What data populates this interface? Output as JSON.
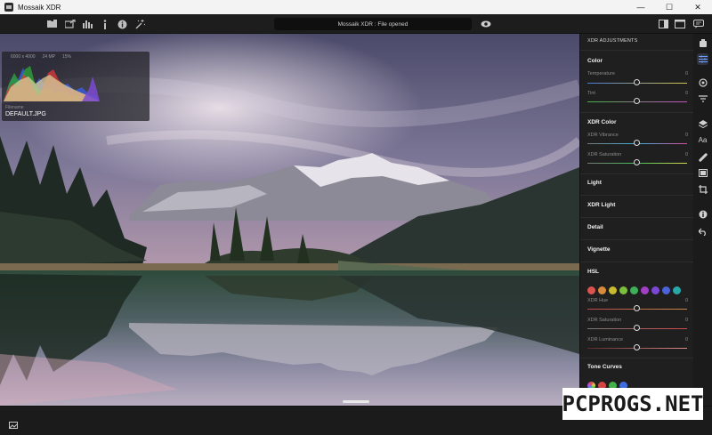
{
  "window": {
    "title": "Mossaik XDR",
    "minimize_glyph": "—",
    "maximize_glyph": "☐",
    "close_glyph": "✕"
  },
  "toolbar": {
    "status_text": "Mossaik XDR : File opened"
  },
  "histogram": {
    "stats": [
      "6000 x 4000",
      "24 MP",
      "15%"
    ],
    "filename_label": "Filename",
    "filename": "DEFAULT.JPG"
  },
  "panel": {
    "title": "XDR ADJUSTMENTS",
    "sections": {
      "color": "Color",
      "xdr_color": "XDR Color",
      "light": "Light",
      "xdr_light": "XDR Light",
      "detail": "Detail",
      "vignette": "Vignette",
      "hsl": "HSL",
      "tone_curves": "Tone Curves"
    },
    "sliders": {
      "temperature": {
        "label": "Temperature",
        "value": "0"
      },
      "tint": {
        "label": "Tint",
        "value": "0"
      },
      "xdr_vibrance": {
        "label": "XDR Vibrance",
        "value": "0"
      },
      "xdr_saturation": {
        "label": "XDR Saturation",
        "value": "0"
      },
      "xdr_hue": {
        "label": "XDR Hue",
        "value": "0"
      },
      "hsl_xdr_saturation": {
        "label": "XDR Saturation",
        "value": "0"
      },
      "xdr_luminance": {
        "label": "XDR Luminance",
        "value": "0"
      }
    },
    "hsl_swatches": [
      "#d9534f",
      "#d98a3a",
      "#c8b92e",
      "#7cbf3a",
      "#3fae58",
      "#a23fc4",
      "#7b48d6",
      "#4c62d8",
      "#2aa7a7"
    ],
    "tone_curve_swatches": [
      "rainbow",
      "#d64545",
      "#43b04a",
      "#3d6ee0"
    ]
  },
  "icons": {
    "toolbar": [
      "open-folder-icon",
      "export-icon",
      "histogram-icon",
      "info-icon",
      "about-icon",
      "magic-wand-icon",
      "eye-icon",
      "split-view-icon",
      "fullscreen-icon",
      "chat-icon"
    ],
    "rail": [
      "presets-icon",
      "adjustments-icon",
      "target-icon",
      "filter-icon",
      "layers-icon",
      "text-icon",
      "healing-icon",
      "frame-icon",
      "crop-icon",
      "info-icon",
      "undo-icon"
    ]
  },
  "watermark": "PCPROGS.NET"
}
